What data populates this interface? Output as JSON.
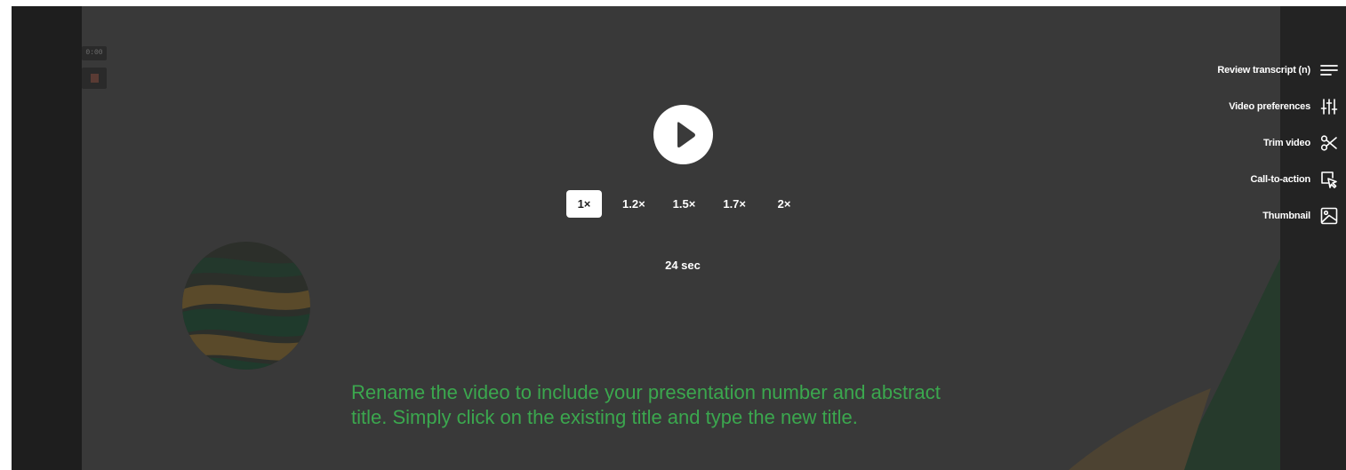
{
  "player": {
    "mini_badge": "0:00",
    "play_button_icon": "play-icon",
    "speeds": [
      {
        "label": "1×",
        "active": true
      },
      {
        "label": "1.2×",
        "active": false
      },
      {
        "label": "1.5×",
        "active": false
      },
      {
        "label": "1.7×",
        "active": false
      },
      {
        "label": "2×",
        "active": false
      }
    ],
    "duration": "24 sec",
    "caption_line1": "Rename the video to include your presentation number and abstract",
    "caption_line2": "title. Simply click on the existing title and type the new title."
  },
  "menu": {
    "items": [
      {
        "label": "Review transcript (n)",
        "icon": "transcript-lines-icon"
      },
      {
        "label": "Video preferences",
        "icon": "sliders-icon"
      },
      {
        "label": "Trim video",
        "icon": "scissors-icon"
      },
      {
        "label": "Call-to-action",
        "icon": "cursor-click-icon"
      },
      {
        "label": "Thumbnail",
        "icon": "image-icon"
      }
    ]
  },
  "colors": {
    "stage": "#393939",
    "frame": "#1e1e1e",
    "caption_green": "#3ba74e",
    "accent_orange": "#8a6a2e",
    "accent_dark_green": "#1f3a2c"
  }
}
